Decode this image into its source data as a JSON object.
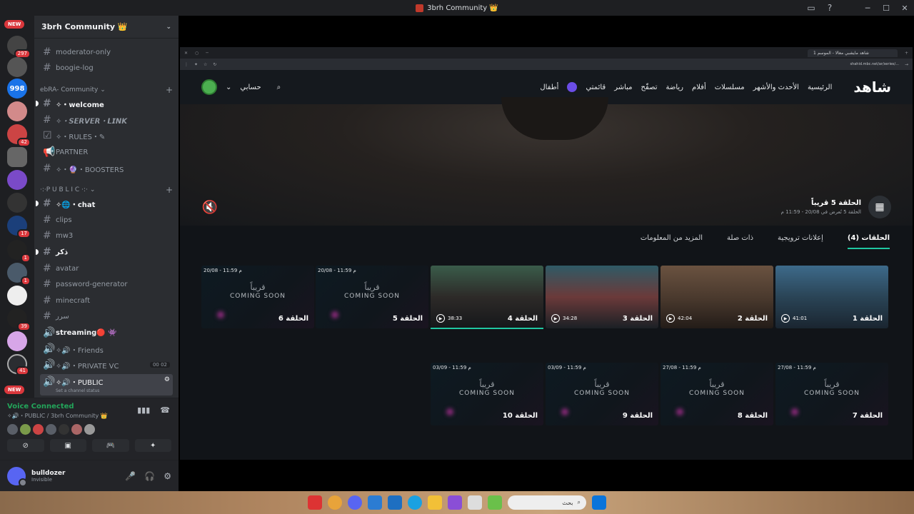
{
  "window": {
    "title": "3brh Community 👑"
  },
  "servers": {
    "new_label": "NEW",
    "badges": [
      "297",
      "42",
      "17",
      "1",
      "1",
      "39",
      "41"
    ],
    "labels": [
      "998"
    ]
  },
  "sidebar": {
    "server_name": "3brh Community 👑",
    "channels_top": [
      "moderator-only",
      "boogie-log"
    ],
    "cat1": "ebRA- Community",
    "cat1_items": [
      "✧・welcome",
      "✧・𝙎𝙀𝙍𝙑𝙀𝙍・𝙇𝙄𝙉𝙆",
      "✧・RULES・✎",
      "PARTNER",
      "✧・🔮・BOOSTERS"
    ],
    "cat2": "·:·P U B L I C ·:·",
    "cat2_items": [
      "✧🌐・chat",
      "clips",
      "mw3",
      "ذكر",
      "avatar",
      "password-generator",
      "minecraft",
      "سرر"
    ],
    "voice_items": [
      "streaming🔴 👾",
      "✧🔊・Friends",
      "✧🔊・PRIVATE VC",
      "✧🔊・PUBLIC"
    ],
    "private_counts": "00 02",
    "public_status": "Set a channel status"
  },
  "voice_panel": {
    "status": "Voice Connected",
    "channel": "✧🔊・PUBLIC / 3brh Community 👑"
  },
  "user": {
    "name": "bulldozer",
    "status": "Invisible"
  },
  "browser": {
    "tab_title": "شاهد مايشبي معالا - الموسم 1",
    "url": "shahid.mbc.net/ar/series/..."
  },
  "shahid": {
    "logo": "شاهد",
    "nav": [
      "الرئيسية",
      "الأحدث والأشهر",
      "مسلسلات",
      "أفلام",
      "رياضة",
      "تصفّح",
      "مباشر",
      "قائمتي",
      "أطفال"
    ],
    "account": "حسابي",
    "next_title": "الحلقة 5 قريباً",
    "next_sub": "الحلقة 5 تُعرض في 20/08 - 11:59 م",
    "tabs": [
      "الحلقات (4)",
      "إعلانات ترويجية",
      "ذات صلة",
      "المزيد من المعلومات"
    ],
    "coming_ar": "قريباً",
    "coming_en": "COMING SOON",
    "row1": [
      {
        "name": "الحلقة 1",
        "dur": "41:01"
      },
      {
        "name": "الحلقة 2",
        "dur": "42:04"
      },
      {
        "name": "الحلقة 3",
        "dur": "34:28"
      },
      {
        "name": "الحلقة 4",
        "dur": "38:33"
      },
      {
        "name": "الحلقة 5",
        "date": "20/08 - 11:59 م"
      },
      {
        "name": "الحلقة 6",
        "date": "20/08 - 11:59 م"
      }
    ],
    "row2": [
      {
        "name": "الحلقة 7",
        "date": "27/08 - 11:59 م"
      },
      {
        "name": "الحلقة 8",
        "date": "27/08 - 11:59 م"
      },
      {
        "name": "الحلقة 9",
        "date": "03/09 - 11:59 م"
      },
      {
        "name": "الحلقة 10",
        "date": "03/09 - 11:59 م"
      }
    ]
  },
  "taskbar": {
    "search": "بحث"
  }
}
